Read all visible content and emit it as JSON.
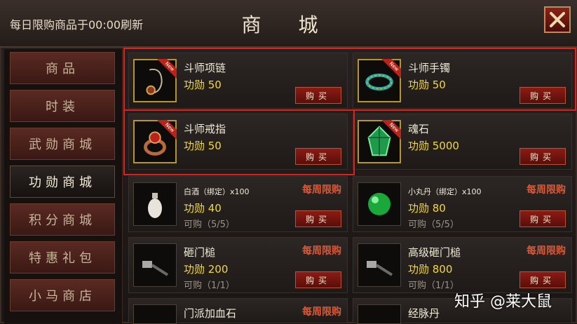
{
  "header": {
    "refresh_note": "每日限购商品于00:00刷新",
    "title": "商 城"
  },
  "sidebar": {
    "items": [
      {
        "label": "商品"
      },
      {
        "label": "时装"
      },
      {
        "label": "武勋商城"
      },
      {
        "label": "功勋商城",
        "active": true
      },
      {
        "label": "积分商城"
      },
      {
        "label": "特惠礼包"
      },
      {
        "label": "小马商店"
      }
    ]
  },
  "items": [
    {
      "name": "斗师项链",
      "price": "功勋  50",
      "buy": "购买",
      "new_tag": "New",
      "icon": "necklace-icon"
    },
    {
      "name": "斗师手镯",
      "price": "功勋  50",
      "buy": "购买",
      "new_tag": "New",
      "icon": "bracelet-icon"
    },
    {
      "name": "斗师戒指",
      "price": "功勋  50",
      "buy": "购买",
      "new_tag": "New",
      "icon": "ring-icon"
    },
    {
      "name": "魂石",
      "price": "功勋  5000",
      "buy": "购买",
      "new_tag": "New",
      "icon": "soul-stone-icon"
    },
    {
      "name": "白酒（绑定）x100",
      "price": "功勋  40",
      "limit": "可购（5/5）",
      "weekly": "每周限购",
      "buy": "购买",
      "icon": "wine-bottle-icon"
    },
    {
      "name": "小丸丹（绑定）x100",
      "price": "功勋  80",
      "limit": "可购（5/5）",
      "weekly": "每周限购",
      "buy": "购买",
      "icon": "green-pill-icon"
    },
    {
      "name": "砸门槌",
      "price": "功勋  200",
      "limit": "可购（1/1）",
      "weekly": "每周限购",
      "buy": "购买",
      "icon": "hammer-icon"
    },
    {
      "name": "高级砸门槌",
      "price": "功勋  800",
      "limit": "可购（1/1）",
      "weekly": "每周限购",
      "buy": "购买",
      "icon": "hammer-icon"
    },
    {
      "name": "门派加血石",
      "weekly": "每周限购"
    },
    {
      "name": "经脉丹"
    }
  ],
  "watermark": "知乎 @莱大鼠",
  "colors": {
    "highlight": "#e0201a",
    "price": "#f2d83a",
    "weekly_limit": "#d65a3a",
    "buy_button": "#8a1c14"
  }
}
